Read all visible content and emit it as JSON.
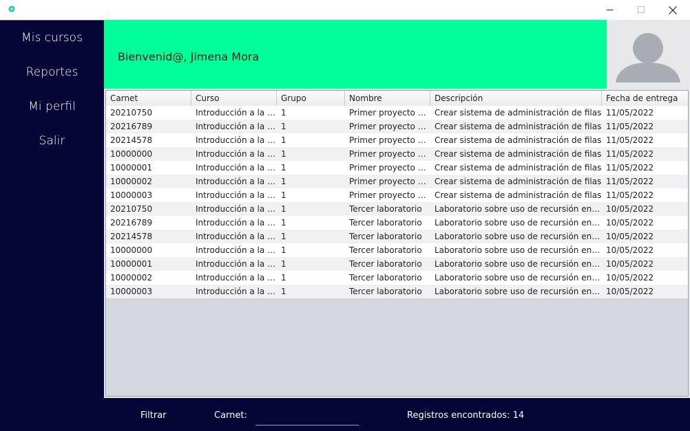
{
  "window": {
    "icon": "app-icon",
    "minimize_glyph": "—",
    "maximize_glyph": "☐",
    "close_glyph": "✕"
  },
  "sidebar": {
    "items": [
      {
        "label": "Mis cursos"
      },
      {
        "label": "Reportes"
      },
      {
        "label": "Mi perfil"
      },
      {
        "label": "Salir"
      }
    ]
  },
  "header": {
    "welcome": "Bienvenid@, Jimena Mora",
    "accent_color": "#00ff99",
    "avatar_icon": "user-avatar-icon"
  },
  "table": {
    "columns": [
      "Carnet",
      "Curso",
      "Grupo",
      "Nombre",
      "Descripción",
      "Fecha de entrega"
    ],
    "rows": [
      [
        "20210750",
        "Introducción a la pr...",
        "1",
        "Primer proyecto pr...",
        "Crear sistema de administración de filas",
        "11/05/2022"
      ],
      [
        "20216789",
        "Introducción a la pr...",
        "1",
        "Primer proyecto pr...",
        "Crear sistema de administración de filas",
        "11/05/2022"
      ],
      [
        "20214578",
        "Introducción a la pr...",
        "1",
        "Primer proyecto pr...",
        "Crear sistema de administración de filas",
        "11/05/2022"
      ],
      [
        "10000000",
        "Introducción a la pr...",
        "1",
        "Primer proyecto pr...",
        "Crear sistema de administración de filas",
        "11/05/2022"
      ],
      [
        "10000001",
        "Introducción a la pr...",
        "1",
        "Primer proyecto pr...",
        "Crear sistema de administración de filas",
        "11/05/2022"
      ],
      [
        "10000002",
        "Introducción a la pr...",
        "1",
        "Primer proyecto pr...",
        "Crear sistema de administración de filas",
        "11/05/2022"
      ],
      [
        "10000003",
        "Introducción a la pr...",
        "1",
        "Primer proyecto pr...",
        "Crear sistema de administración de filas",
        "11/05/2022"
      ],
      [
        "20210750",
        "Introducción a la pr...",
        "1",
        "Tercer laboratorio",
        "Laboratorio sobre uso de recursión en Pyt...",
        "10/05/2022"
      ],
      [
        "20216789",
        "Introducción a la pr...",
        "1",
        "Tercer laboratorio",
        "Laboratorio sobre uso de recursión en Pyt...",
        "10/05/2022"
      ],
      [
        "20214578",
        "Introducción a la pr...",
        "1",
        "Tercer laboratorio",
        "Laboratorio sobre uso de recursión en Pyt...",
        "10/05/2022"
      ],
      [
        "10000000",
        "Introducción a la pr...",
        "1",
        "Tercer laboratorio",
        "Laboratorio sobre uso de recursión en Pyt...",
        "10/05/2022"
      ],
      [
        "10000001",
        "Introducción a la pr...",
        "1",
        "Tercer laboratorio",
        "Laboratorio sobre uso de recursión en Pyt...",
        "10/05/2022"
      ],
      [
        "10000002",
        "Introducción a la pr...",
        "1",
        "Tercer laboratorio",
        "Laboratorio sobre uso de recursión en Pyt...",
        "10/05/2022"
      ],
      [
        "10000003",
        "Introducción a la pr...",
        "1",
        "Tercer laboratorio",
        "Laboratorio sobre uso de recursión en Pyt...",
        "10/05/2022"
      ]
    ]
  },
  "footer": {
    "filter_label": "Filtrar",
    "carnet_label": "Carnet:",
    "carnet_value": "",
    "records_text": "Registros encontrados: 14"
  }
}
